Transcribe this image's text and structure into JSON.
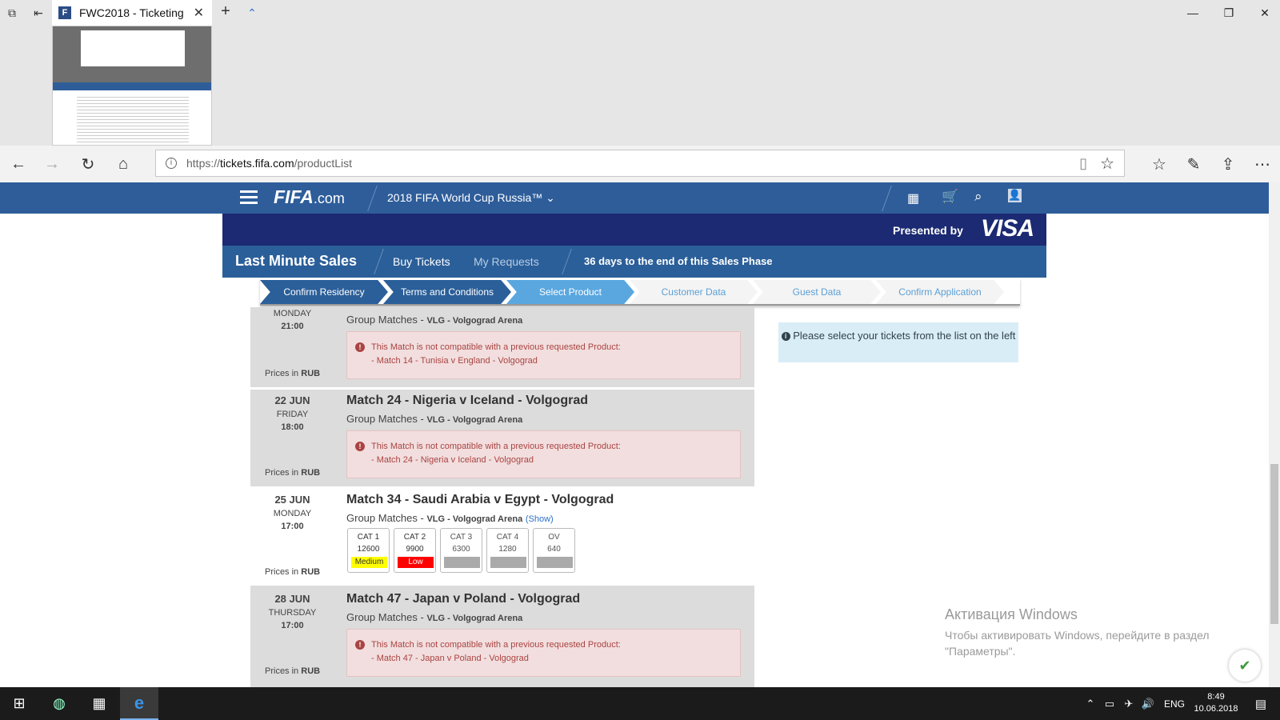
{
  "browser": {
    "tab_title": "FWC2018 - Ticketing",
    "tab_close": "✕",
    "new_tab": "+",
    "tab_favicon": "F",
    "url_scheme": "https://",
    "url_host": "tickets.fifa.com",
    "url_path": "/productList"
  },
  "header": {
    "logo_fifa": "FIFA",
    "logo_com": ".com",
    "tournament": "2018 FIFA World Cup Russia™",
    "presented_by": "Presented by",
    "sponsor": "VISA"
  },
  "sales": {
    "title": "Last Minute Sales",
    "nav_buy": "Buy Tickets",
    "nav_requests": "My Requests",
    "phase_notice": "36 days to the end of this Sales Phase"
  },
  "steps": [
    {
      "label": "Confirm Residency",
      "state": "done"
    },
    {
      "label": "Terms and Conditions",
      "state": "done"
    },
    {
      "label": "Select Product",
      "state": "active"
    },
    {
      "label": "Customer Data",
      "state": "todo"
    },
    {
      "label": "Guest Data",
      "state": "todo"
    },
    {
      "label": "Confirm Application",
      "state": "todo"
    }
  ],
  "matches": [
    {
      "day": "",
      "weekday": "MONDAY",
      "time": "21:00",
      "title": "",
      "group": "Group Matches - ",
      "venue": "VLG - Volgograd Arena",
      "warning_line1": "This Match is not compatible with a previous requested Product:",
      "warning_line2": "- Match 14 - Tunisia v England - Volgograd",
      "prices_label": "Prices in ",
      "currency": "RUB"
    },
    {
      "day": "22 JUN",
      "weekday": "FRIDAY",
      "time": "18:00",
      "title": "Match 24 - Nigeria v Iceland - Volgograd",
      "group": "Group Matches - ",
      "venue": "VLG - Volgograd Arena",
      "warning_line1": "This Match is not compatible with a previous requested Product:",
      "warning_line2": "- Match 24 - Nigeria v Iceland - Volgograd",
      "prices_label": "Prices in ",
      "currency": "RUB"
    },
    {
      "day": "25 JUN",
      "weekday": "MONDAY",
      "time": "17:00",
      "title": "Match 34 - Saudi Arabia v Egypt - Volgograd",
      "group": "Group Matches - ",
      "venue": "VLG - Volgograd Arena",
      "show_link": "(Show)",
      "prices_label": "Prices in ",
      "currency": "RUB",
      "categories": [
        {
          "name": "CAT 1",
          "price": "12600",
          "availability": "Medium",
          "color": "#ffff00"
        },
        {
          "name": "CAT 2",
          "price": "9900",
          "availability": "Low",
          "color": "#ff0000"
        },
        {
          "name": "CAT 3",
          "price": "6300",
          "availability": "",
          "color": "#aaaaaa"
        },
        {
          "name": "CAT 4",
          "price": "1280",
          "availability": "",
          "color": "#aaaaaa"
        },
        {
          "name": "OV",
          "price": "640",
          "availability": "",
          "color": "#aaaaaa"
        }
      ]
    },
    {
      "day": "28 JUN",
      "weekday": "THURSDAY",
      "time": "17:00",
      "title": "Match 47 - Japan v Poland - Volgograd",
      "group": "Group Matches - ",
      "venue": "VLG - Volgograd Arena",
      "warning_line1": "This Match is not compatible with a previous requested Product:",
      "warning_line2": "- Match 47 - Japan v Poland - Volgograd",
      "prices_label": "Prices in ",
      "currency": "RUB"
    }
  ],
  "info": {
    "text": "Please select your tickets from the list on the left"
  },
  "activation": {
    "title": "Активация Windows",
    "line": "Чтобы активировать Windows, перейдите в раздел \"Параметры\"."
  },
  "taskbar": {
    "lang": "ENG",
    "time": "8:49",
    "date": "10.06.2018"
  },
  "colors": {
    "fifa_blue": "#2e5d9a",
    "visa_navy": "#1b2a72",
    "step_done": "#2b5f99",
    "step_active": "#5aa7e0",
    "warning_bg": "#f2dede"
  }
}
